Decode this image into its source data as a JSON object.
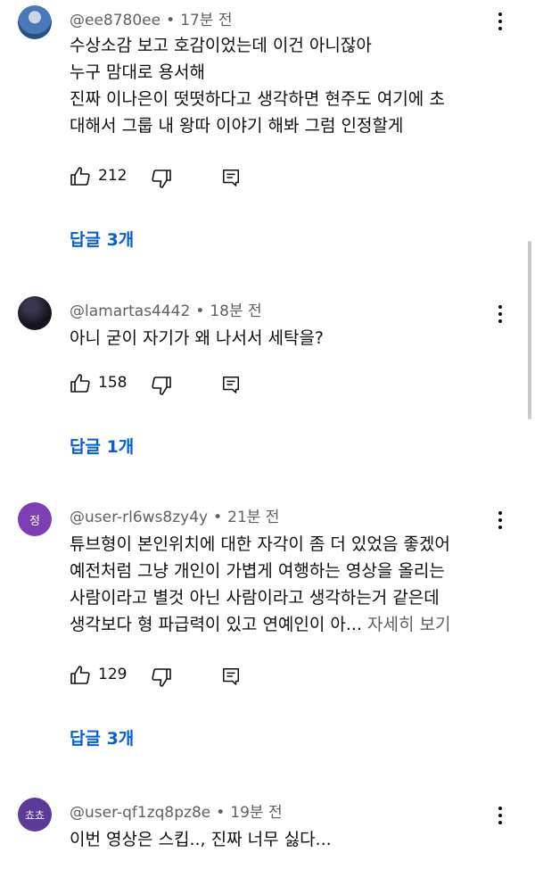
{
  "comments": [
    {
      "handle": "@ee8780ee",
      "time": "17분 전",
      "lines": [
        "수상소감 보고 호감이었는데 이건 아니잖아",
        "누구 맘대로 용서해",
        "진짜 이나은이 떳떳하다고 생각하면 현주도 여기에 초",
        "대해서 그룹 내 왕따 이야기 해봐 그럼 인정할게"
      ],
      "likes": "212",
      "replies": "답글 3개"
    },
    {
      "handle": "@lamartas4442",
      "time": "18분 전",
      "lines": [
        "아니 굳이 자기가 왜 나서서 세탁을?"
      ],
      "likes": "158",
      "replies": "답글 1개"
    },
    {
      "handle": "@user-rl6ws8zy4y",
      "time": "21분 전",
      "avatar_text": "정",
      "lines": [
        "튜브형이 본인위치에 대한 자각이 좀 더 있었음 좋겠어",
        "예전처럼 그냥 개인이 가볍게 여행하는 영상을 올리는",
        "사람이라고 별것 아닌 사람이라고 생각하는거 같은데",
        "생각보다 형 파급력이 있고 연예인이 아..."
      ],
      "more": "자세히 보기",
      "likes": "129",
      "replies": "답글 3개"
    },
    {
      "handle": "@user-qf1zq8pz8e",
      "time": "19분 전",
      "avatar_text": "쵸쵸",
      "lines": [
        "이번 영상은 스킵.., 진짜 너무 싫다..."
      ]
    }
  ],
  "meta_separator": "•",
  "icons": {
    "like": "thumbs-up-icon",
    "dislike": "thumbs-down-icon",
    "reply": "reply-icon",
    "menu": "more-vert-icon"
  },
  "colors": {
    "reply_link": "#065fd4",
    "meta": "#606060",
    "text": "#0f0f0f"
  }
}
